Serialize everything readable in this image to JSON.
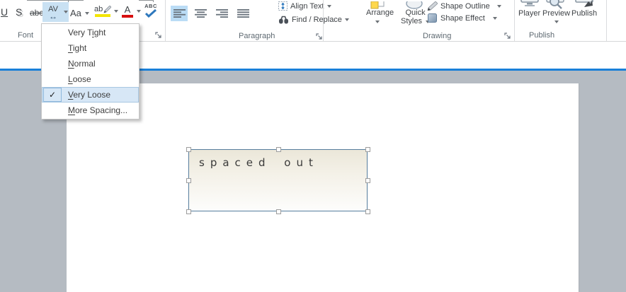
{
  "icons": {
    "check": "✓",
    "char_spacing_arrow": "↔"
  },
  "colors": {
    "accent_line": "#1a80d8",
    "button_highlight": "#c9e1f3",
    "menu_highlight_bg": "#d7e7f6",
    "menu_highlight_border": "#a8c7e2",
    "highlight_yellow": "#f3e500",
    "font_color_red": "#d70f0f",
    "canvas_gray": "#b5bbc2",
    "textbox_border": "#567d9e"
  },
  "ribbon": {
    "font_group": {
      "label": "Font",
      "underline": "U",
      "shadow": "S",
      "strikethrough": "abc",
      "char_spacing": "AV",
      "change_case": "Aa",
      "highlight": "ab",
      "font_color": "A",
      "spell_check": "ABC"
    },
    "paragraph_group": {
      "label": "Paragraph",
      "align_text": "Align Text",
      "find_replace": "Find / Replace"
    },
    "drawing_group": {
      "label": "Drawing",
      "arrange": "Arrange",
      "quick": "Quick",
      "styles": "Styles",
      "shape_outline": "Shape Outline",
      "shape_effect": "Shape Effect"
    },
    "publish_group": {
      "label": "Publish",
      "player": "Player",
      "preview": "Preview",
      "publish": "Publish"
    }
  },
  "menu": {
    "items": [
      {
        "pre": "Very T",
        "key": "i",
        "post": "ght",
        "checked": false,
        "highlighted": false
      },
      {
        "pre": "",
        "key": "T",
        "post": "ight",
        "checked": false,
        "highlighted": false
      },
      {
        "pre": "",
        "key": "N",
        "post": "ormal",
        "checked": false,
        "highlighted": false
      },
      {
        "pre": "",
        "key": "L",
        "post": "oose",
        "checked": false,
        "highlighted": false
      },
      {
        "pre": "",
        "key": "V",
        "post": "ery Loose",
        "checked": true,
        "highlighted": true
      },
      {
        "pre": "",
        "key": "M",
        "post": "ore Spacing...",
        "checked": false,
        "highlighted": false
      }
    ]
  },
  "slide": {
    "textbox_text": "spaced out"
  }
}
